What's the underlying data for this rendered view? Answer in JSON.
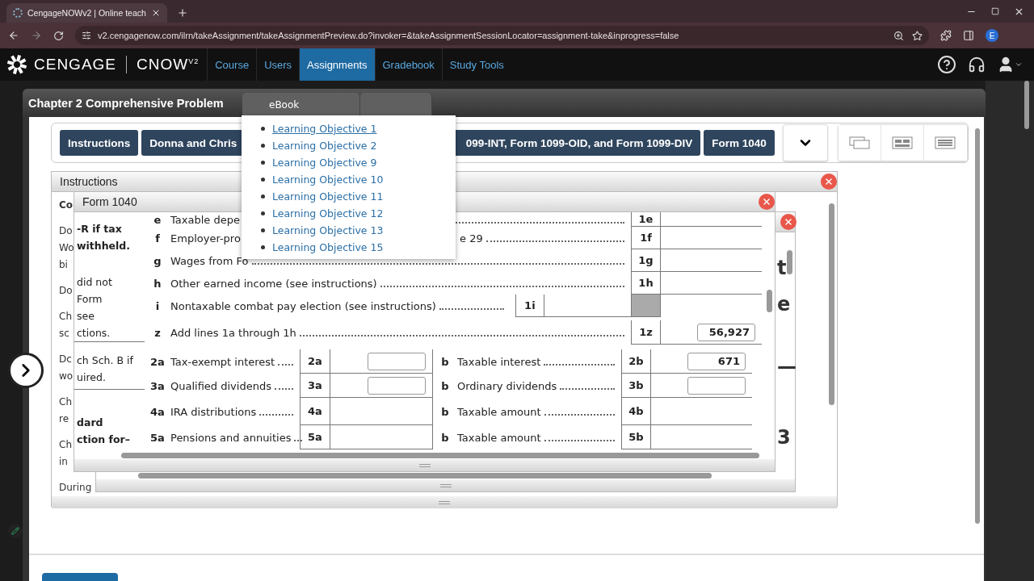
{
  "browser": {
    "tab_title": "CengageNOWv2 | Online teach",
    "url": "v2.cengagenow.com/ilrn/takeAssignment/takeAssignmentPreview.do?invoker=&takeAssignmentSessionLocator=assignment-take&inprogress=false",
    "profile_initial": "E"
  },
  "app_nav": {
    "brand": "CENGAGE",
    "product": "CNOW",
    "product_sup": "V2",
    "items": [
      {
        "label": "Course",
        "selected": false
      },
      {
        "label": "Users",
        "selected": false
      },
      {
        "label": "Assignments",
        "selected": true
      },
      {
        "label": "Gradebook",
        "selected": false
      },
      {
        "label": "Study Tools",
        "selected": false
      }
    ]
  },
  "assignment": {
    "title": "Chapter 2 Comprehensive Problem",
    "ebook_tab": "eBook"
  },
  "ebook_menu": [
    {
      "label": "Learning Objective 1",
      "hovered": true
    },
    {
      "label": "Learning Objective 2",
      "hovered": false
    },
    {
      "label": "Learning Objective 9",
      "hovered": false
    },
    {
      "label": "Learning Objective 10",
      "hovered": false
    },
    {
      "label": "Learning Objective 11",
      "hovered": false
    },
    {
      "label": "Learning Objective 12",
      "hovered": false
    },
    {
      "label": "Learning Objective 13",
      "hovered": false
    },
    {
      "label": "Learning Objective 15",
      "hovered": false
    }
  ],
  "section_tabs": [
    {
      "label": "Instructions",
      "kind": "plain"
    },
    {
      "label": "Donna and Chris",
      "kind": "cut_right"
    },
    {
      "label": "099-INT, Form 1099-OID, and Form 1099-DIV",
      "kind": "cut_left"
    },
    {
      "label": "Form 1040",
      "kind": "plain"
    }
  ],
  "instructions_panel": {
    "title": "Instructions",
    "paragraphs": [
      {
        "lines": [
          "Co"
        ],
        "bold": true
      },
      {
        "lines": [
          "Do",
          "Wo",
          "bi"
        ],
        "bold": false
      },
      {
        "lines": [
          "Do"
        ],
        "bold": false
      },
      {
        "lines": [
          "Ch",
          "sc"
        ],
        "bold": false
      },
      {
        "lines": [
          "Dc",
          "wo"
        ],
        "bold": false
      },
      {
        "lines": [
          "Ch",
          "re"
        ],
        "bold": false
      },
      {
        "lines": [
          "Ch",
          "in"
        ],
        "bold": false
      },
      {
        "lines": [
          "During"
        ],
        "bold": false
      }
    ]
  },
  "back_window": {
    "glyphs": [
      "t",
      "e",
      "—",
      "3"
    ]
  },
  "form_window": {
    "title": "Form 1040",
    "margin_notes": [
      {
        "lines": [
          "-R if tax",
          "withheld."
        ],
        "bold": true
      },
      {
        "lines": [
          "did not",
          "Form",
          "see",
          "ctions."
        ],
        "bold": false
      },
      {
        "lines": [
          "ch Sch. B if",
          "uired."
        ],
        "bold": false
      },
      {
        "lines": [
          "dard",
          "ction for–"
        ],
        "bold": true
      }
    ],
    "income_rows": [
      {
        "kind": "line",
        "letter": "e",
        "label": "Taxable depe",
        "code": "1e"
      },
      {
        "kind": "line",
        "letter": "f",
        "label": "Employer-pro",
        "label_tail": "e 29",
        "code": "1f"
      },
      {
        "kind": "line",
        "letter": "g",
        "label": "Wages from Fo",
        "code": "1g"
      },
      {
        "kind": "line",
        "letter": "h",
        "label": "Other earned income (see instructions)",
        "code": "1h"
      },
      {
        "kind": "inline",
        "letter": "i",
        "label": "Nontaxable combat pay election (see instructions)",
        "code": "1i"
      },
      {
        "kind": "total",
        "letter": "z",
        "label": "Add lines 1a through 1h",
        "code": "1z",
        "value": "56,927"
      }
    ],
    "pair_rows": [
      {
        "num": "2a",
        "label": "Tax-exempt interest",
        "code": "2a",
        "kind": "input",
        "b": {
          "letter": "b",
          "label": "Taxable interest",
          "code": "2b",
          "kind": "input",
          "value": "671"
        }
      },
      {
        "num": "3a",
        "label": "Qualified dividends",
        "code": "3a",
        "kind": "input",
        "b": {
          "letter": "b",
          "label": "Ordinary dividends",
          "code": "3b",
          "kind": "input"
        }
      },
      {
        "num": "4a",
        "label": "IRA distributions",
        "code": "4a",
        "kind": "blank",
        "b": {
          "letter": "b",
          "label": "Taxable amount",
          "code": "4b",
          "kind": "blank"
        }
      },
      {
        "num": "5a",
        "label": "Pensions and annuities",
        "code": "5a",
        "kind": "blank",
        "b": {
          "letter": "b",
          "label": "Taxable amount",
          "code": "5b",
          "kind": "blank"
        }
      }
    ]
  }
}
